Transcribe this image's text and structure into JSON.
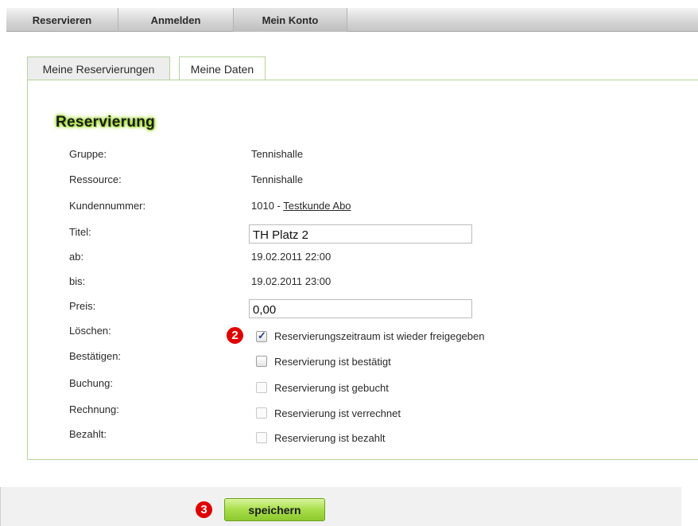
{
  "nav": {
    "items": [
      {
        "label": "Reservieren"
      },
      {
        "label": "Anmelden"
      },
      {
        "label": "Mein Konto"
      }
    ]
  },
  "tabs": [
    {
      "label": "Meine Reservierungen"
    },
    {
      "label": "Meine Daten"
    }
  ],
  "section_title": "Reservierung",
  "fields": {
    "gruppe": {
      "label": "Gruppe:",
      "value": "Tennishalle"
    },
    "ressource": {
      "label": "Ressource:",
      "value": "Tennishalle"
    },
    "kundennummer": {
      "label": "Kundennummer:",
      "number": "1010 - ",
      "name": "Testkunde Abo"
    },
    "titel": {
      "label": "Titel:",
      "value": "TH Platz 2"
    },
    "ab": {
      "label": "ab:",
      "value": "19.02.2011 22:00"
    },
    "bis": {
      "label": "bis:",
      "value": "19.02.2011 23:00"
    },
    "preis": {
      "label": "Preis:",
      "value": "0,00"
    }
  },
  "checkboxes": {
    "loeschen": {
      "label": "Löschen:",
      "text": "Reservierungszeitraum ist wieder freigegeben",
      "checked": true
    },
    "bestaetigen": {
      "label": "Bestätigen:",
      "text": "Reservierung ist bestätigt",
      "checked": false
    },
    "buchung": {
      "label": "Buchung:",
      "text": "Reservierung ist gebucht",
      "checked": false
    },
    "rechnung": {
      "label": "Rechnung:",
      "text": "Reservierung ist verrechnet",
      "checked": false
    },
    "bezahlt": {
      "label": "Bezahlt:",
      "text": "Reservierung ist bezahlt",
      "checked": false
    }
  },
  "markers": {
    "two": "2",
    "three": "3"
  },
  "save_label": "speichern",
  "colors": {
    "accent_green": "#9ad22e",
    "marker_red": "#e00000"
  }
}
